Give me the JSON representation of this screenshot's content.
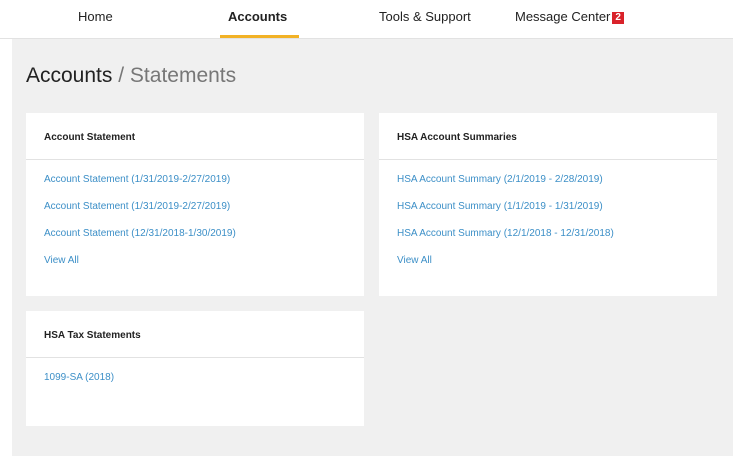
{
  "nav": {
    "home": "Home",
    "accounts": "Accounts",
    "tools": "Tools & Support",
    "messages": "Message Center",
    "message_count": "2",
    "accent_color": "#f2b226",
    "badge_color": "#d9222a"
  },
  "page": {
    "crumb_root": "Accounts",
    "crumb_sep": "/",
    "crumb_current": "Statements"
  },
  "cards": {
    "account_statement": {
      "title": "Account Statement",
      "links": [
        "Account Statement (1/31/2019-2/27/2019)",
        "Account Statement (1/31/2019-2/27/2019)",
        "Account Statement (12/31/2018-1/30/2019)"
      ],
      "view_all": "View All"
    },
    "hsa_summaries": {
      "title": "HSA Account Summaries",
      "links": [
        "HSA Account Summary (2/1/2019 - 2/28/2019)",
        "HSA Account Summary (1/1/2019 - 1/31/2019)",
        "HSA Account Summary (12/1/2018 - 12/31/2018)"
      ],
      "view_all": "View All"
    },
    "hsa_tax": {
      "title": "HSA Tax Statements",
      "links": [
        "1099-SA (2018)"
      ]
    }
  },
  "link_color": "#3c8fc7"
}
